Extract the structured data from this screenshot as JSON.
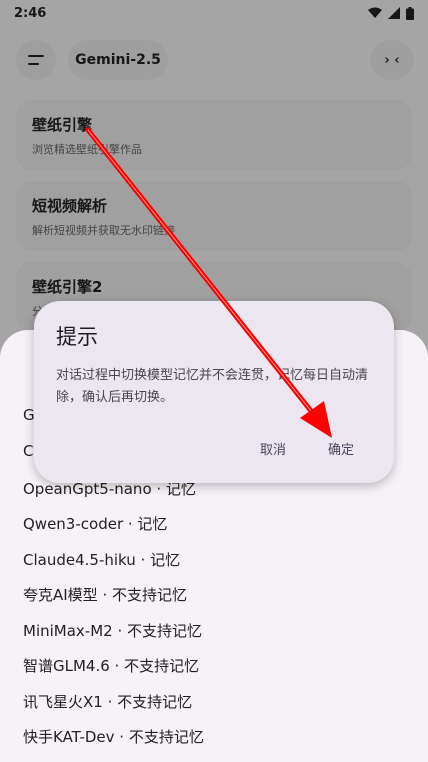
{
  "status_bar": {
    "time": "2:46"
  },
  "top_bar": {
    "model_name": "Gemini-2.5",
    "right_button_label": "› ‹"
  },
  "cards": [
    {
      "title": "壁纸引擎",
      "subtitle": "浏览精选壁纸引擎作品"
    },
    {
      "title": "短视频解析",
      "subtitle": "解析短视频并获取无水印链接"
    },
    {
      "title": "壁纸引擎2",
      "subtitle": "分"
    }
  ],
  "model_sheet": {
    "items": [
      "G",
      "C",
      "OpeanGpt5-nano · 记忆",
      "Qwen3-coder · 记忆",
      "Claude4.5-hiku · 记忆",
      "夸克AI模型 · 不支持记忆",
      "MiniMax-M2 · 不支持记忆",
      "智谱GLM4.6 · 不支持记忆",
      "讯飞星火X1 · 不支持记忆",
      "快手KAT-Dev · 不支持记忆"
    ]
  },
  "dialog": {
    "title": "提示",
    "body": "对话过程中切换模型记忆并不会连贯，记忆每日自动清除，确认后再切换。",
    "cancel_label": "取消",
    "confirm_label": "确定"
  },
  "colors": {
    "annotation_arrow": "#ff0000",
    "dialog_bg": "#ece6f0",
    "sheet_bg": "#f6f2f8"
  }
}
